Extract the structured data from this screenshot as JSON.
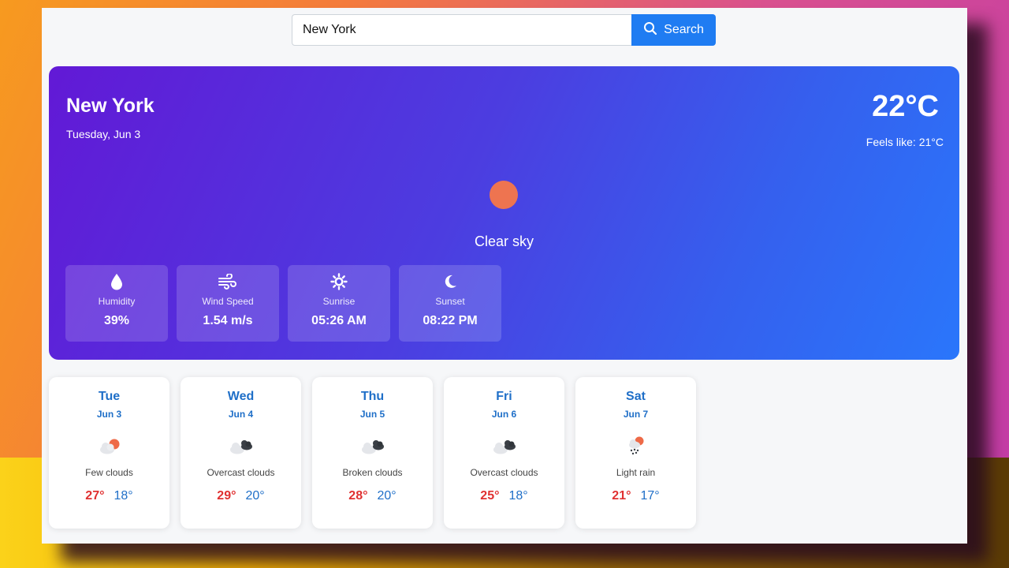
{
  "search": {
    "value": "New York",
    "button_label": "Search"
  },
  "current": {
    "city": "New York",
    "date": "Tuesday, Jun 3",
    "temperature": "22°C",
    "feels_like": "Feels like: 21°C",
    "condition": "Clear sky",
    "icon": "clear-sun-icon"
  },
  "stats": [
    {
      "icon": "water-drop-icon",
      "label": "Humidity",
      "value": "39%"
    },
    {
      "icon": "wind-icon",
      "label": "Wind Speed",
      "value": "1.54 m/s"
    },
    {
      "icon": "sunrise-icon",
      "label": "Sunrise",
      "value": "05:26 AM"
    },
    {
      "icon": "moon-icon",
      "label": "Sunset",
      "value": "08:22 PM"
    }
  ],
  "forecast": [
    {
      "day": "Tue",
      "date": "Jun 3",
      "icon": "few-clouds-icon",
      "description": "Few clouds",
      "high": "27°",
      "low": "18°"
    },
    {
      "day": "Wed",
      "date": "Jun 4",
      "icon": "overcast-clouds-icon",
      "description": "Overcast clouds",
      "high": "29°",
      "low": "20°"
    },
    {
      "day": "Thu",
      "date": "Jun 5",
      "icon": "broken-clouds-icon",
      "description": "Broken clouds",
      "high": "28°",
      "low": "20°"
    },
    {
      "day": "Fri",
      "date": "Jun 6",
      "icon": "overcast-clouds-icon",
      "description": "Overcast clouds",
      "high": "25°",
      "low": "18°"
    },
    {
      "day": "Sat",
      "date": "Jun 7",
      "icon": "light-rain-icon",
      "description": "Light rain",
      "high": "21°",
      "low": "17°"
    }
  ],
  "colors": {
    "accent": "#1f7cf2",
    "hero_start": "#6219d6",
    "hero_end": "#2a76fb",
    "sun": "#ee7450",
    "high_temp": "#e03131",
    "low_temp": "#1f6fc8"
  }
}
